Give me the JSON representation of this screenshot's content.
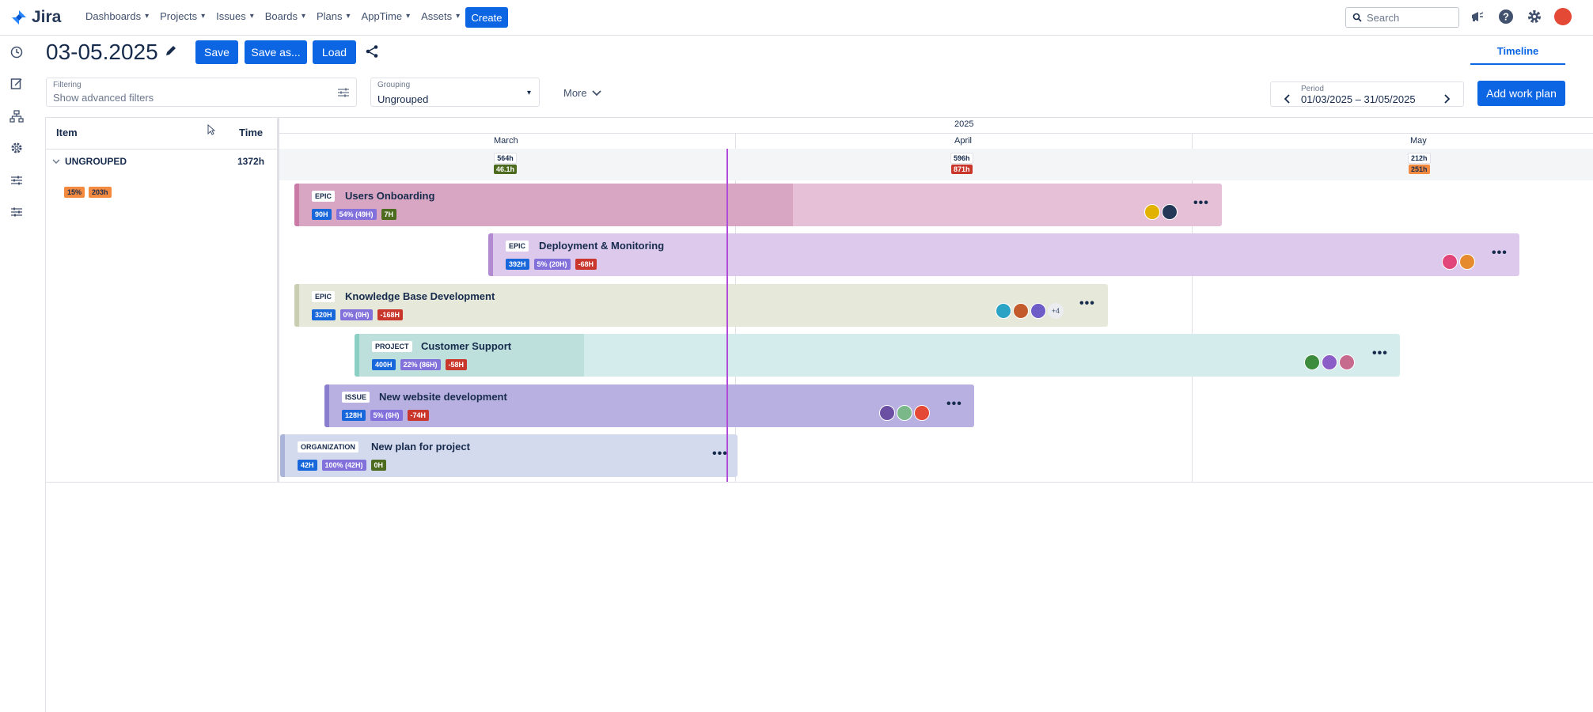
{
  "app": {
    "logo_text": "Jira"
  },
  "nav": {
    "items": [
      "Dashboards",
      "Projects",
      "Issues",
      "Boards",
      "Plans",
      "AppTime",
      "Assets"
    ],
    "create_label": "Create",
    "search_placeholder": "Search"
  },
  "toolbar": {
    "title": "03-05.2025",
    "save_label": "Save",
    "save_as_label": "Save as...",
    "load_label": "Load",
    "tab_timeline": "Timeline"
  },
  "filters": {
    "filtering_label": "Filtering",
    "filtering_placeholder": "Show advanced filters",
    "grouping_label": "Grouping",
    "grouping_value": "Ungrouped",
    "more_label": "More",
    "period_label": "Period",
    "period_value": "01/03/2025 – 31/05/2025",
    "add_work_plan_label": "Add work plan"
  },
  "grid": {
    "col_item": "Item",
    "col_time": "Time",
    "group": {
      "label": "UNGROUPED",
      "time": "1372h",
      "pct": "15%",
      "hours": "203h"
    },
    "year": "2025",
    "months": [
      {
        "name": "March",
        "cap_total": "564h",
        "cap_remaining": "46.1h",
        "remaining_color": "#4c6b1f"
      },
      {
        "name": "April",
        "cap_total": "596h",
        "cap_remaining": "871h",
        "remaining_color": "#c9372c"
      },
      {
        "name": "May",
        "cap_total": "212h",
        "cap_remaining": "251h",
        "remaining_color": "#f38a3f"
      }
    ]
  },
  "bars": [
    {
      "type": "EPIC",
      "name": "Users Onboarding",
      "b1": "90H",
      "b2": "54% (49H)",
      "b3": "7H",
      "b3_color": "green"
    },
    {
      "type": "EPIC",
      "name": "Deployment & Monitoring",
      "b1": "392H",
      "b2": "5% (20H)",
      "b3": "-68H",
      "b3_color": "red"
    },
    {
      "type": "EPIC",
      "name": "Knowledge Base Development",
      "b1": "320H",
      "b2": "0% (0H)",
      "b3": "-168H",
      "b3_color": "red",
      "more_avatars": "+4"
    },
    {
      "type": "PROJECT",
      "name": "Customer Support",
      "b1": "400H",
      "b2": "22% (86H)",
      "b3": "-58H",
      "b3_color": "red"
    },
    {
      "type": "ISSUE",
      "name": "New website development",
      "b1": "128H",
      "b2": "5% (6H)",
      "b3": "-74H",
      "b3_color": "red"
    },
    {
      "type": "ORGANIZATION",
      "name": "New plan for project",
      "b1": "42H",
      "b2": "100% (42H)",
      "b3": "0H",
      "b3_color": "green"
    }
  ]
}
